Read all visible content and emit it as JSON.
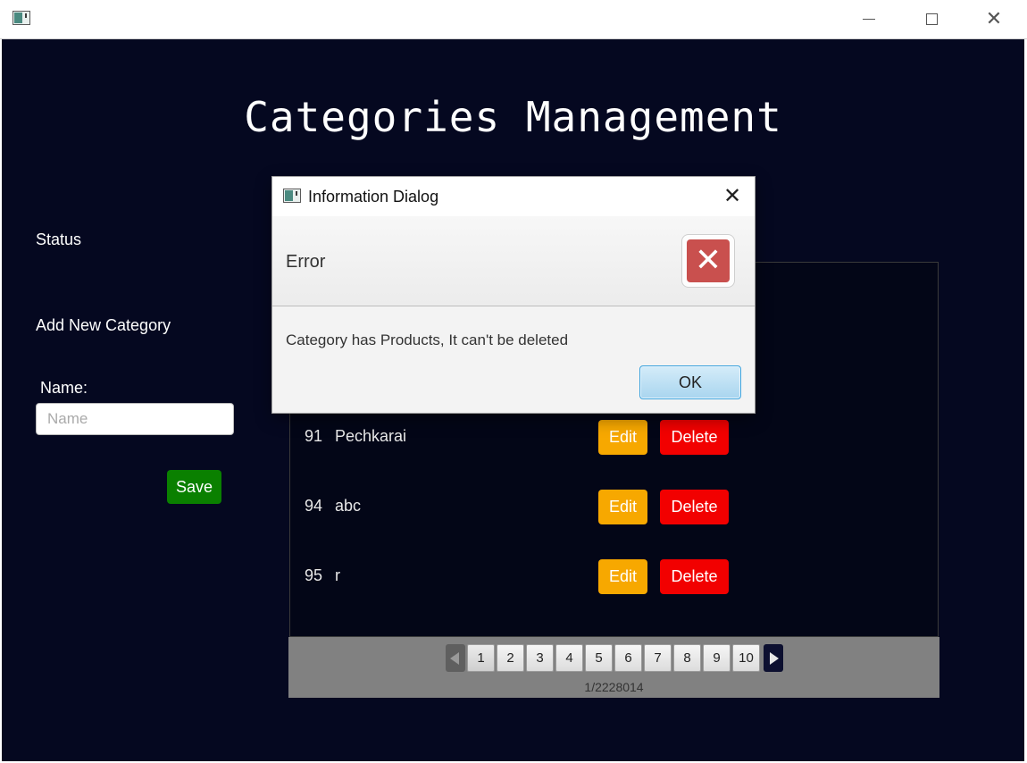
{
  "window": {
    "title": ""
  },
  "main": {
    "title": "Categories Management",
    "status_label": "Status",
    "add_label": "Add New Category",
    "name_label": "Name:",
    "name_placeholder": "Name",
    "save_label": "Save"
  },
  "table": {
    "rows": [
      {
        "id": "91",
        "name": "Pechkarai",
        "edit": "Edit",
        "delete": "Delete"
      },
      {
        "id": "94",
        "name": "abc",
        "edit": "Edit",
        "delete": "Delete"
      },
      {
        "id": "95",
        "name": "r",
        "edit": "Edit",
        "delete": "Delete"
      }
    ]
  },
  "pagination": {
    "pages": [
      "1",
      "2",
      "3",
      "4",
      "5",
      "6",
      "7",
      "8",
      "9",
      "10"
    ],
    "current": "1",
    "info": "1/2228014"
  },
  "dialog": {
    "title": "Information Dialog",
    "header": "Error",
    "content": "Category has Products, It can't be deleted",
    "ok_label": "OK",
    "icon": "error-icon",
    "icon_color": "#c9504e"
  },
  "colors": {
    "background": "#050820",
    "save": "#0a8000",
    "edit": "#f7a800",
    "delete": "#f20000"
  }
}
